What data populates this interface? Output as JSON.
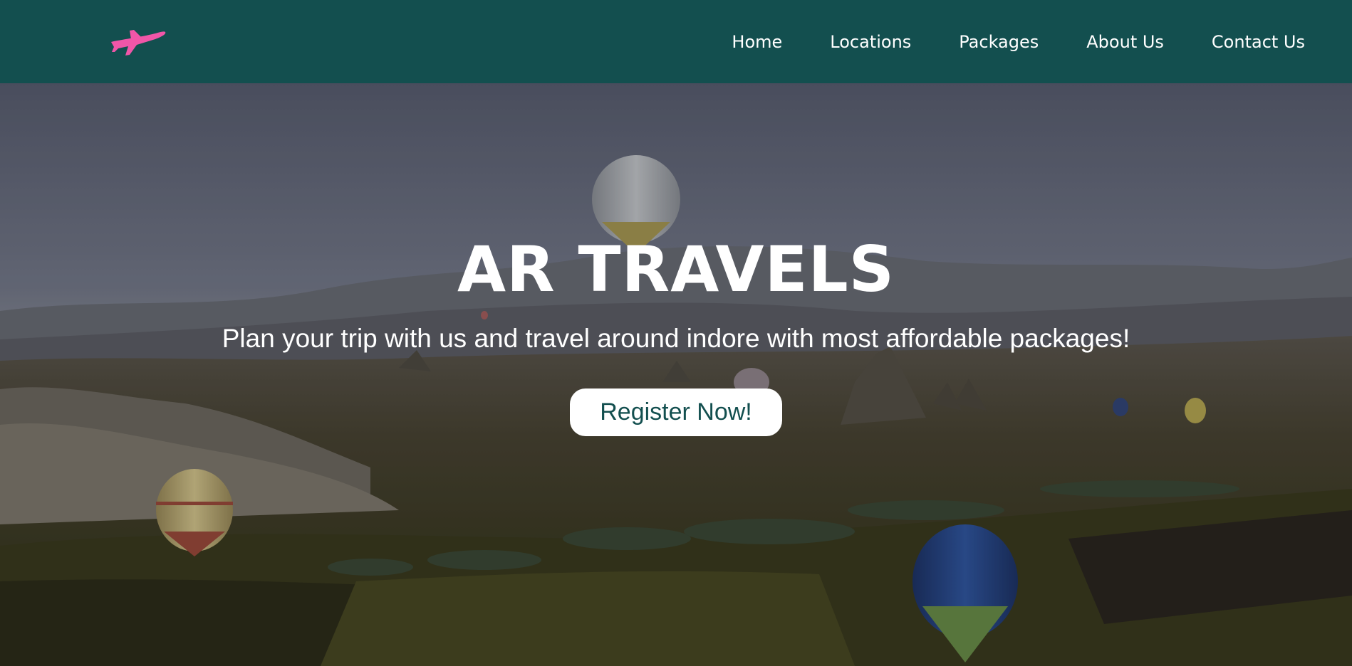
{
  "navbar": {
    "logo_icon": "airplane-icon",
    "background_color": "#134f4f",
    "logo_color": "#f056a8",
    "links": [
      {
        "label": "Home"
      },
      {
        "label": "Locations"
      },
      {
        "label": "Packages"
      },
      {
        "label": "About Us"
      },
      {
        "label": "Contact Us"
      }
    ]
  },
  "hero": {
    "title": "AR TRAVELS",
    "subtitle": "Plan your trip with us and travel around indore with most affordable packages!",
    "cta_label": "Register Now!",
    "background_description_icon": "hot-air-balloons-landscape-image"
  }
}
